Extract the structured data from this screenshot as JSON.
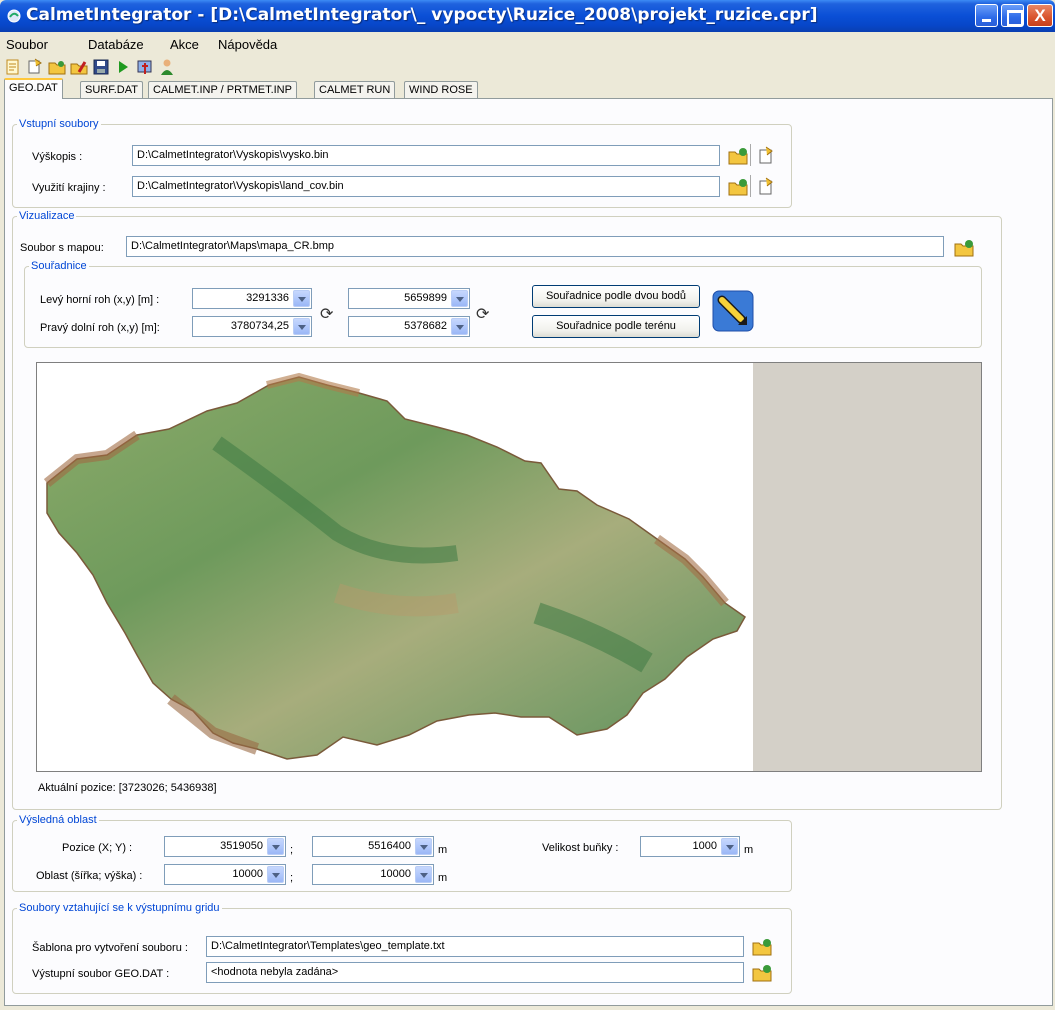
{
  "window": {
    "title": "CalmetIntegrator - [D:\\CalmetIntegrator\\_ vypocty\\Ruzice_2008\\projekt_ruzice.cpr]",
    "close_glyph": "X"
  },
  "menu": [
    "Soubor",
    "Databáze",
    "Akce",
    "Nápověda"
  ],
  "toolbar_icons": [
    "new-icon",
    "open-icon",
    "open-folder-icon",
    "edit-icon",
    "save-icon",
    "run-icon",
    "export-icon",
    "user-icon"
  ],
  "tabs": [
    "GEO.DAT",
    "SURF.DAT",
    "CALMET.INP / PRTMET.INP",
    "CALMET RUN",
    "WIND ROSE"
  ],
  "input_files": {
    "legend": "Vstupní soubory",
    "elevation_label": "Výškopis :",
    "elevation_value": "D:\\CalmetIntegrator\\Vyskopis\\vysko.bin",
    "landuse_label": "Využití krajiny :",
    "landuse_value": "D:\\CalmetIntegrator\\Vyskopis\\land_cov.bin"
  },
  "visualization": {
    "legend": "Vizualizace",
    "map_file_label": "Soubor s mapou:",
    "map_file_value": "D:\\CalmetIntegrator\\Maps\\mapa_CR.bmp",
    "coords": {
      "legend": "Souřadnice",
      "top_left_label": "Levý horní roh (x,y) [m] :",
      "bottom_right_label": "Pravý dolní roh (x,y) [m]:",
      "top_left_x": "3291336",
      "top_left_y": "5659899",
      "bottom_right_x": "3780734,25",
      "bottom_right_y": "5378682",
      "btn_two_points": "Souřadnice podle dvou bodů",
      "btn_terrain": "Souřadnice podle terénu",
      "refresh_glyph": "⟳"
    },
    "current_position": "Aktuální pozice: [3723026; 5436938]"
  },
  "result_area": {
    "legend": "Výsledná oblast",
    "position_label": "Pozice (X; Y) :",
    "pos_x": "3519050",
    "pos_y": "5516400",
    "area_label": "Oblast (šířka; výška) :",
    "width": "10000",
    "height": "10000",
    "separator": ";",
    "unit": "m",
    "cell_label": "Velikost buňky :",
    "cell": "1000"
  },
  "output_files": {
    "legend": "Soubory vztahující se k výstupnímu gridu",
    "template_label": "Šablona pro vytvoření souboru :",
    "template_value": "D:\\CalmetIntegrator\\Templates\\geo_template.txt",
    "output_label": "Výstupní soubor GEO.DAT :",
    "output_value": "<hodnota nebyla zadána>"
  }
}
